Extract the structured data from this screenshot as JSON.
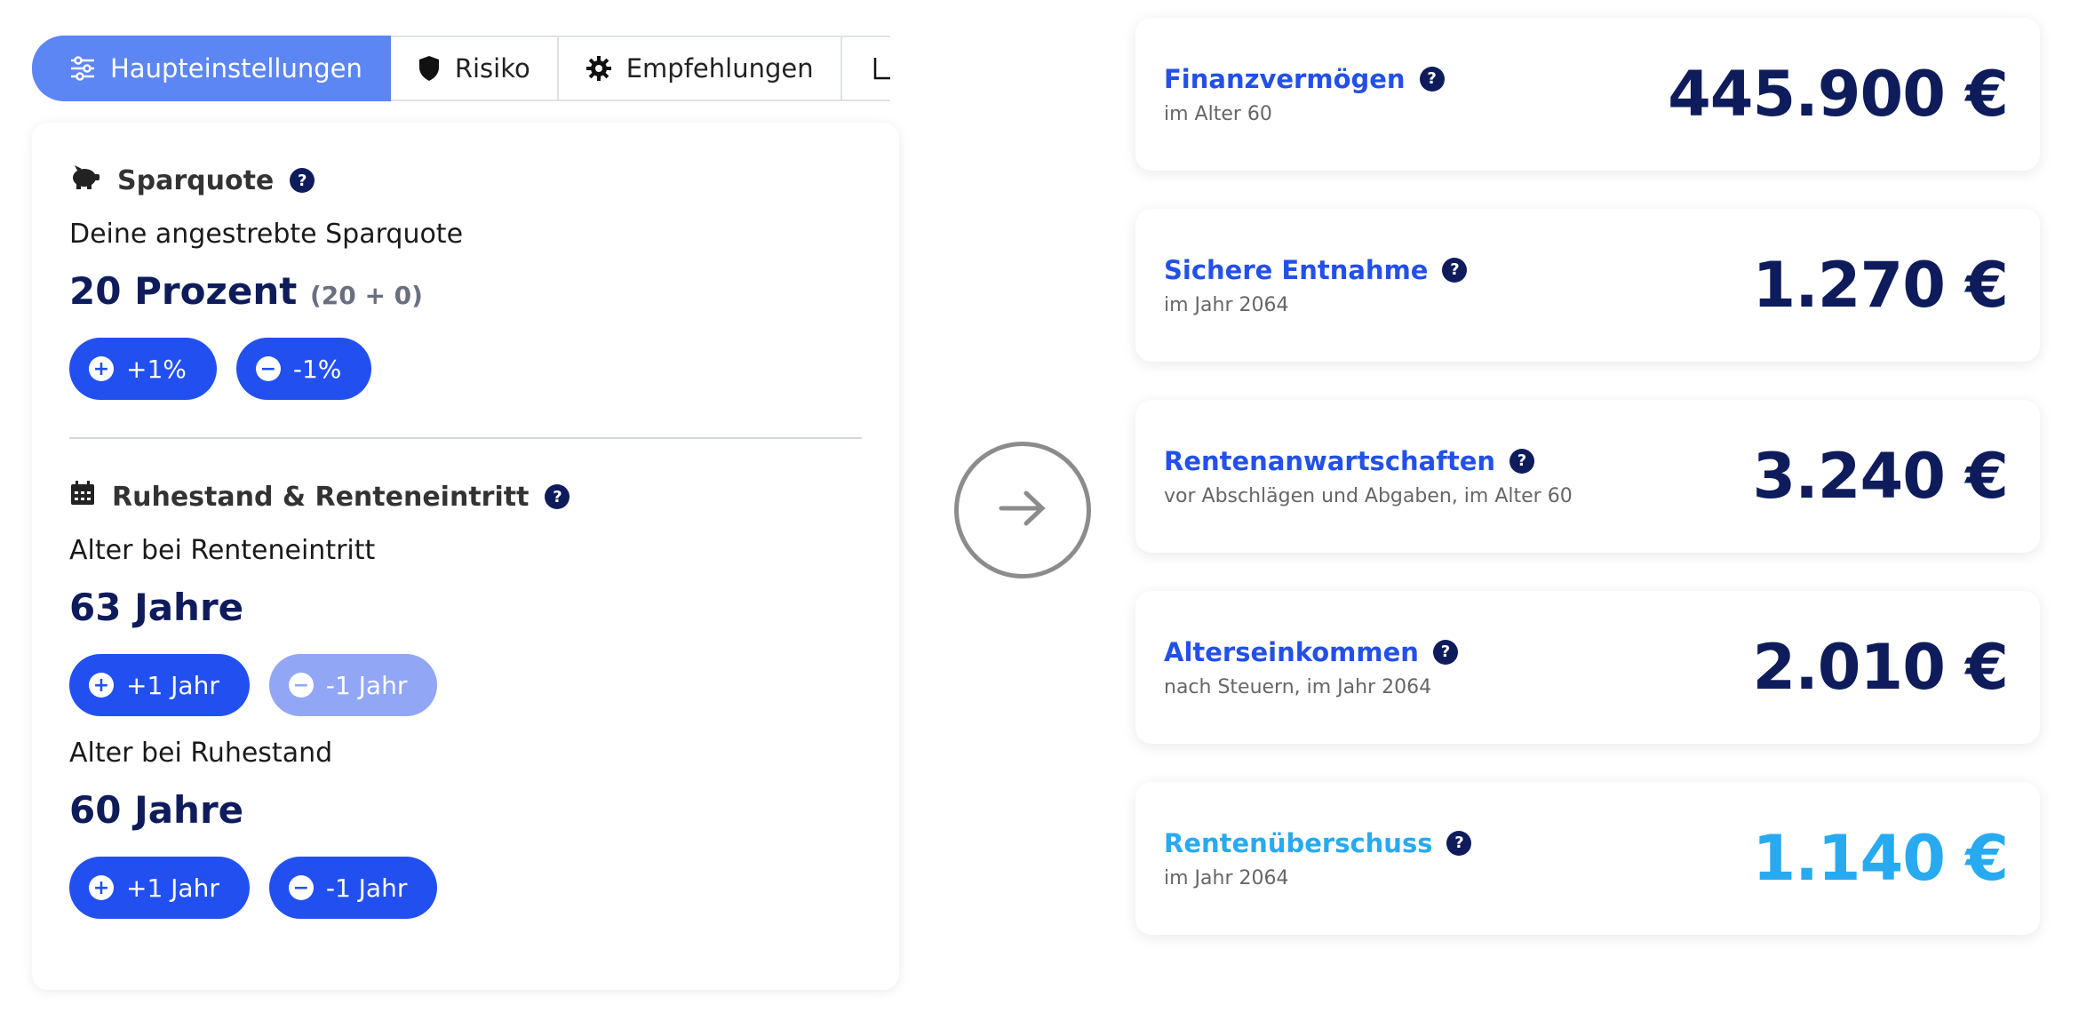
{
  "tabs": [
    {
      "label": "Haupteinstellungen",
      "icon": "sliders-icon",
      "active": true
    },
    {
      "label": "Risiko",
      "icon": "shield-icon"
    },
    {
      "label": "Empfehlungen",
      "icon": "gear-icon"
    }
  ],
  "sparquote": {
    "heading": "Sparquote",
    "help": "?",
    "label": "Deine angestrebte Sparquote",
    "value": "20 Prozent",
    "detail": "(20 + 0)",
    "plus_label": "+1%",
    "minus_label": "-1%"
  },
  "ruhestand": {
    "heading": "Ruhestand & Renteneintritt",
    "help": "?",
    "rente_label": "Alter bei Renteneintritt",
    "rente_value": "63 Jahre",
    "rente_plus": "+1 Jahr",
    "rente_minus": "-1 Jahr",
    "ruhe_label": "Alter bei Ruhestand",
    "ruhe_value": "60 Jahre",
    "ruhe_plus": "+1 Jahr",
    "ruhe_minus": "-1 Jahr"
  },
  "results": [
    {
      "title": "Finanzvermögen",
      "subtitle": "im Alter 60",
      "value": "445.900 €"
    },
    {
      "title": "Sichere Entnahme",
      "subtitle": "im Jahr 2064",
      "value": "1.270 €"
    },
    {
      "title": "Rentenanwartschaften",
      "subtitle": "vor Abschlägen und Abgaben, im Alter 60",
      "value": "3.240 €"
    },
    {
      "title": "Alterseinkommen",
      "subtitle": "nach Steuern, im Jahr 2064",
      "value": "2.010 €"
    },
    {
      "title": "Rentenüberschuss",
      "subtitle": "im Jahr 2064",
      "value": "1.140 €"
    }
  ],
  "colors": {
    "primary": "#2250f0",
    "navy": "#0f1c5c",
    "tab_active": "#5d86f5",
    "surplus": "#27aaf0",
    "disabled": "#91a7f5"
  }
}
